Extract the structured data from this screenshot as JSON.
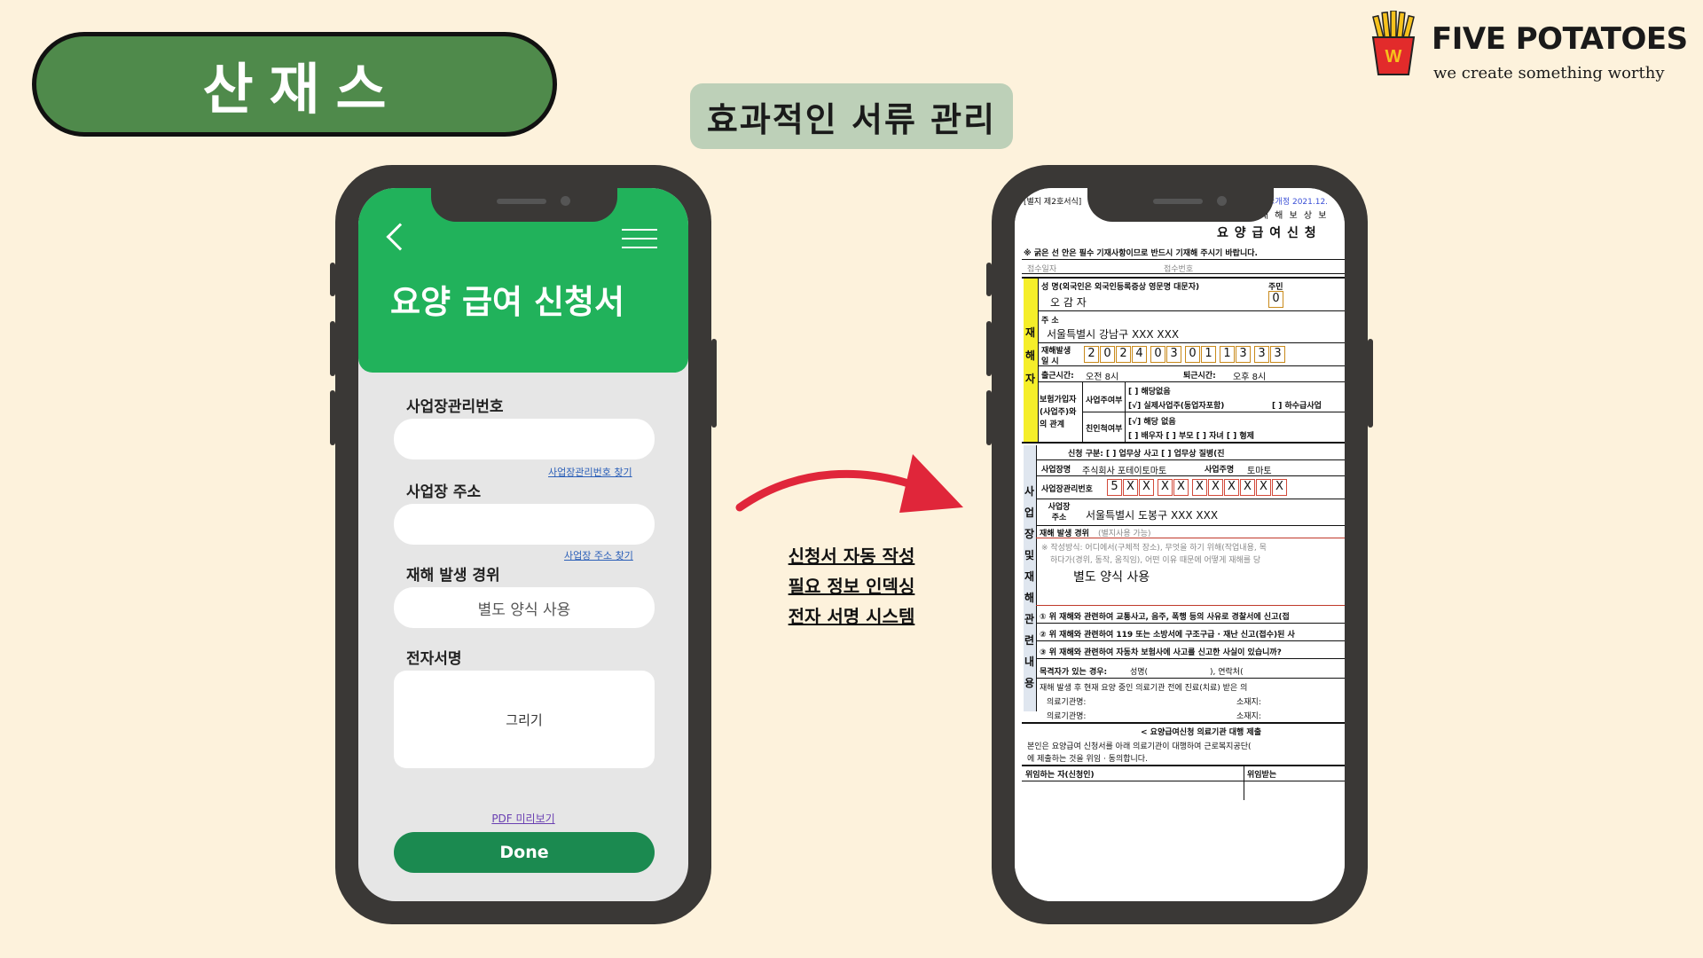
{
  "brand": {
    "name": "FIVE POTATOES",
    "tagline": "we create something worthy",
    "logo_letter": "W"
  },
  "header": {
    "title": "산재스",
    "subtitle": "효과적인 서류 관리"
  },
  "app": {
    "title": "요양 급여 신청서",
    "fields": [
      {
        "label": "사업장관리번호",
        "value": "",
        "link": "사업장관리번호 찾기"
      },
      {
        "label": "사업장 주소",
        "value": "",
        "link": "사업장 주소 찾기"
      },
      {
        "label": "재해 발생 경위",
        "value": "별도 양식 사용"
      },
      {
        "label": "전자서명",
        "value": "그리기"
      }
    ],
    "pdf_link": "PDF 미리보기",
    "done_label": "Done"
  },
  "features": [
    "신청서 자동 작성",
    "필요 정보 인덱싱",
    "전자 서명 시스템"
  ],
  "document": {
    "form_no": "[별지 제2호서식]",
    "revised": "<개정 2021.12.",
    "header_small": "산 업 재 해 보 상 보",
    "title": "요 양 급 여 신 청",
    "notice": "※ 굵은 선 안은 필수 기재사항이므로 반드시 기재해 주시기 바랍니다.",
    "receipt_date": "접수일자",
    "receipt_no": "접수번호",
    "name_label": "성 명(외국인은 외국인등록증상 영문명 대문자)",
    "name_value": "오 감 자",
    "resident_label": "주민",
    "address_label": "주 소",
    "address_value": "서울특별시 강남구 XXX XXX",
    "accident_dt_label": "재해발생 일 시",
    "accident_digits": [
      "2",
      "0",
      "2",
      "4",
      "0",
      "3",
      "0",
      "1",
      "1",
      "3",
      "3",
      "3"
    ],
    "commute_in_label": "출근시간:",
    "commute_in": "오전 8시",
    "commute_out_label": "퇴근시간:",
    "commute_out": "오후 8시",
    "insured_label": "보험가입자(사업주)와의 관계",
    "owner_label": "사업주여부",
    "relative_label": "친인척여부",
    "opt_none": "[ ] 해당없음",
    "opt_actual": "[√] 실제사업주(동업자포함)",
    "opt_sub": "[ ] 하수급사업",
    "opt_none2": "[√] 해당 없음",
    "opt_family": "[ ] 배우자  [ ] 부모  [ ] 자녀  [ ] 형제",
    "victim_side": "재해자",
    "apply_type": "신청 구분:  [ ] 업무상 사고    [ ] 업무상 질병(진",
    "company_label": "사업장명",
    "company_value": "주식회사 포테이토마토",
    "owner_name_label": "사업주명",
    "owner_name_value": "토마토",
    "biz_no_label": "사업장관리번호",
    "biz_no_boxes": [
      "5",
      "X",
      "X",
      "X",
      "X",
      "X",
      "X",
      "X",
      "X",
      "X",
      "X"
    ],
    "biz_addr_label": "사업장 주소",
    "biz_addr_value": "서울특별시 도봉구 XXX XXX",
    "accident_detail_label": "재해 발생 경위",
    "accident_detail_note": "(별지사용 가능)",
    "accident_hint": "※ 작성방식: 어디에서(구체적 장소), 무엇을 하기 위해(작업내용, 목",
    "accident_hint2": "하다가(경위, 동작, 움직임), 어떤 이유 때문에 어떻게 재해를 당",
    "accident_detail_value": "별도 양식 사용",
    "side_section": "사업장 및 재해 관련 내용",
    "q1": "① 위 재해와 관련하여 교통사고, 음주, 폭행 등의 사유로 경찰서에 신고(접",
    "q2": "② 위 재해와 관련하여 119 또는 소방서에 구조구급 · 재난 신고(접수)된 사",
    "q3": "③ 위 재해와 관련하여 자동차 보험사에 사고를 신고한 사실이 있습니까?",
    "witness_label": "목격자가 있는 경우:",
    "witness_name": "성명(",
    "witness_contact": "), 연락처(",
    "treatment_note": "재해 발생 후 현재 요양 중인 의료기관 전에 진료(치료) 받은 의",
    "hospital1": "의료기관명:",
    "location1": "소재지:",
    "hospital2": "의료기관명:",
    "location2": "소재지:",
    "proxy_title": "< 요양급여신청 의료기관 대행 제출",
    "proxy_text1": "본인은 요양급여 신청서를 아래 의료기관이 대행하여 근로복지공단(",
    "proxy_text2": "에 제출하는 것을 위임 · 동의합니다.",
    "delegator": "위임하는 자(신청인)",
    "delegatee": "위임받는"
  },
  "colors": {
    "background": "#fdf2dc",
    "pill": "#4f8a4b",
    "subtitle_bg": "#bdd0b8",
    "app_green": "#21b25b",
    "done_green": "#1b8a50",
    "arrow_red": "#e0263a",
    "phone_frame": "#3a3836"
  },
  "icons": [
    "back-chevron-icon",
    "hamburger-menu-icon",
    "fries-logo-icon",
    "curved-arrow-icon"
  ]
}
